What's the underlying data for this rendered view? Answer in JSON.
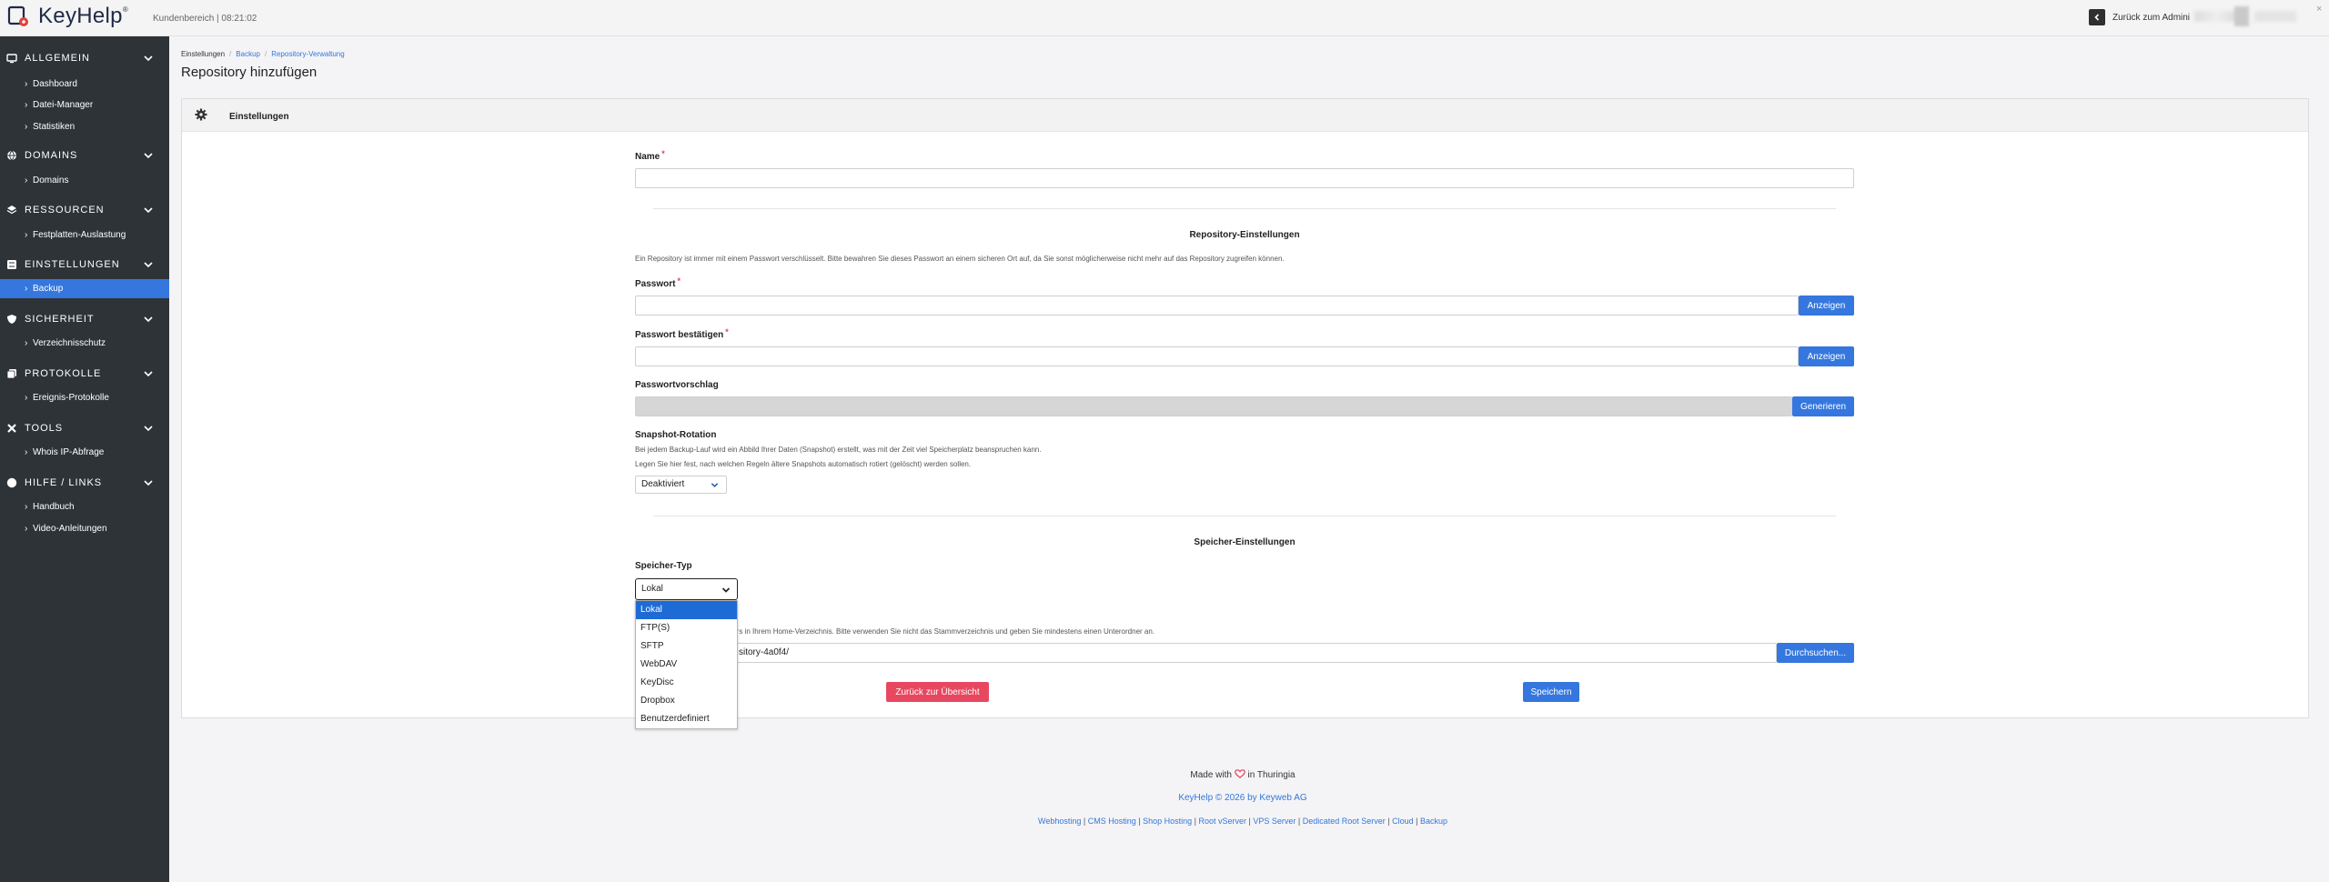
{
  "topbar": {
    "brand": "KeyHelp",
    "brand_mark": "®",
    "info": "Kundenbereich | 08:21:02",
    "back_label": "Zurück zum Admini"
  },
  "sidebar": {
    "sections": [
      {
        "label": "ALLGEMEIN",
        "icon": "monitor-icon",
        "items": [
          "Dashboard",
          "Datei-Manager",
          "Statistiken"
        ]
      },
      {
        "label": "DOMAINS",
        "icon": "globe-icon",
        "items": [
          "Domains"
        ]
      },
      {
        "label": "RESSOURCEN",
        "icon": "layers-icon",
        "items": [
          "Festplatten-Auslastung"
        ]
      },
      {
        "label": "EINSTELLUNGEN",
        "icon": "sliders-icon",
        "items": [
          "Backup"
        ]
      },
      {
        "label": "SICHERHEIT",
        "icon": "shield-icon",
        "items": [
          "Verzeichnisschutz"
        ]
      },
      {
        "label": "PROTOKOLLE",
        "icon": "logs-icon",
        "items": [
          "Ereignis-Protokolle"
        ]
      },
      {
        "label": "TOOLS",
        "icon": "tools-icon",
        "items": [
          "Whois IP-Abfrage"
        ]
      },
      {
        "label": "HILFE / LINKS",
        "icon": "info-icon",
        "items": [
          "Handbuch",
          "Video-Anleitungen"
        ]
      }
    ],
    "active_item": "Backup"
  },
  "breadcrumb": [
    "Einstellungen",
    "Backup",
    "Repository-Verwaltung"
  ],
  "page_title": "Repository hinzufügen",
  "card": {
    "title": "Einstellungen",
    "name_label": "Name",
    "repo_section_title": "Repository-Einstellungen",
    "repo_hint": "Ein Repository ist immer mit einem Passwort verschlüsselt. Bitte bewahren Sie dieses Passwort an einem sicheren Ort auf, da Sie sonst möglicherweise nicht mehr auf das Repository zugreifen können.",
    "password_label": "Passwort",
    "password_confirm_label": "Passwort bestätigen",
    "show_label": "Anzeigen",
    "suggestion_label": "Passwortvorschlag",
    "generate_label": "Generieren",
    "snapshot_label": "Snapshot-Rotation",
    "snapshot_hint1": "Bei jedem Backup-Lauf wird ein Abbild Ihrer Daten (Snapshot) erstellt, was mit der Zeit viel Speicherplatz beanspruchen kann.",
    "snapshot_hint2": "Legen Sie hier fest, nach welchen Regeln ältere Snapshots automatisch rotiert (gelöscht) werden sollen.",
    "snapshot_value": "Deaktiviert",
    "storage_section_title": "Speicher-Einstellungen",
    "storage_type_label": "Speicher-Typ",
    "storage_type_value": "Lokal",
    "storage_options": [
      "Lokal",
      "FTP(S)",
      "SFTP",
      "WebDAV",
      "KeyDisc",
      "Dropbox",
      "Benutzerdefiniert"
    ],
    "path_hint": "/ Ordners in Ihrem Home-Verzeichnis. Bitte verwenden Sie nicht das Stammverzeichnis und geben Sie mindestens einen Unterordner an.",
    "path_value": "sitory-4a0f4/",
    "browse_label": "Durchsuchen...",
    "back_button": "Zurück zur Übersicht",
    "save_button": "Speichern"
  },
  "footer": {
    "made_with_pre": "Made with",
    "made_with_post": "in Thuringia",
    "copyright": "KeyHelp © 2026 by Keyweb AG",
    "links": [
      "Webhosting",
      "CMS Hosting",
      "Shop Hosting",
      "Root vServer",
      "VPS Server",
      "Dedicated Root Server",
      "Cloud",
      "Backup"
    ]
  },
  "colors": {
    "accent": "#3577de",
    "danger": "#e8485f",
    "sidebar_bg": "#2e3338"
  }
}
